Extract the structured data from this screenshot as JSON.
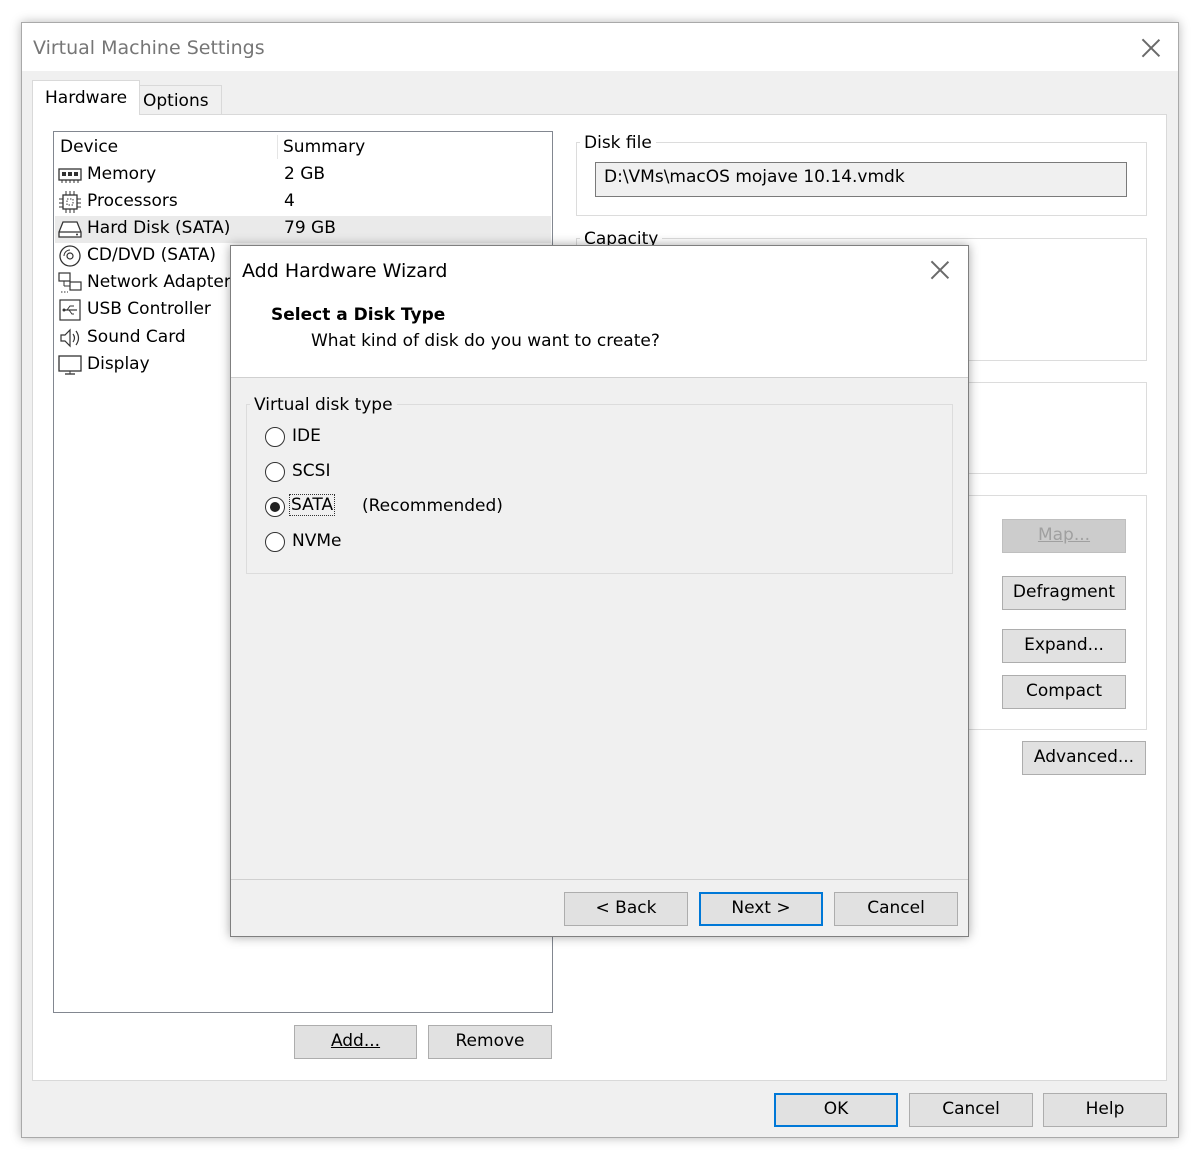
{
  "window": {
    "title": "Virtual Machine Settings",
    "tabs": [
      {
        "label": "Hardware",
        "active": true
      },
      {
        "label": "Options",
        "active": false
      }
    ]
  },
  "device_list": {
    "columns": [
      "Device",
      "Summary"
    ],
    "rows": [
      {
        "icon": "memory-icon",
        "name": "Memory",
        "summary": "2 GB"
      },
      {
        "icon": "processor-icon",
        "name": "Processors",
        "summary": "4"
      },
      {
        "icon": "hard-disk-icon",
        "name": "Hard Disk (SATA)",
        "summary": "79 GB",
        "selected": true
      },
      {
        "icon": "cd-dvd-icon",
        "name": "CD/DVD (SATA)",
        "summary": ""
      },
      {
        "icon": "network-adapter-icon",
        "name": "Network Adapter",
        "summary": ""
      },
      {
        "icon": "usb-icon",
        "name": "USB Controller",
        "summary": ""
      },
      {
        "icon": "sound-card-icon",
        "name": "Sound Card",
        "summary": ""
      },
      {
        "icon": "display-icon",
        "name": "Display",
        "summary": ""
      }
    ]
  },
  "list_buttons": {
    "add": "Add...",
    "remove": "Remove"
  },
  "disk_panel": {
    "disk_file_label": "Disk file",
    "disk_file_value": "D:\\VMs\\macOS mojave 10.14.vmdk",
    "capacity_label": "Capacity",
    "buttons": {
      "map": "Map...",
      "defragment": "Defragment",
      "expand": "Expand...",
      "compact": "Compact",
      "advanced": "Advanced..."
    }
  },
  "footer_buttons": {
    "ok": "OK",
    "cancel": "Cancel",
    "help": "Help"
  },
  "wizard": {
    "title": "Add Hardware Wizard",
    "heading": "Select a Disk Type",
    "subheading": "What kind of disk do you want to create?",
    "group_label": "Virtual disk type",
    "options": [
      {
        "label": "IDE",
        "checked": false
      },
      {
        "label": "SCSI",
        "checked": false
      },
      {
        "label": "SATA",
        "checked": true,
        "note": "(Recommended)"
      },
      {
        "label": "NVMe",
        "checked": false
      }
    ],
    "buttons": {
      "back": "< Back",
      "next": "Next >",
      "cancel": "Cancel"
    }
  },
  "colors": {
    "dialog_bg": "#f0f0f0",
    "focus_border": "#0078d7",
    "selected_row": "#eaeaea"
  }
}
